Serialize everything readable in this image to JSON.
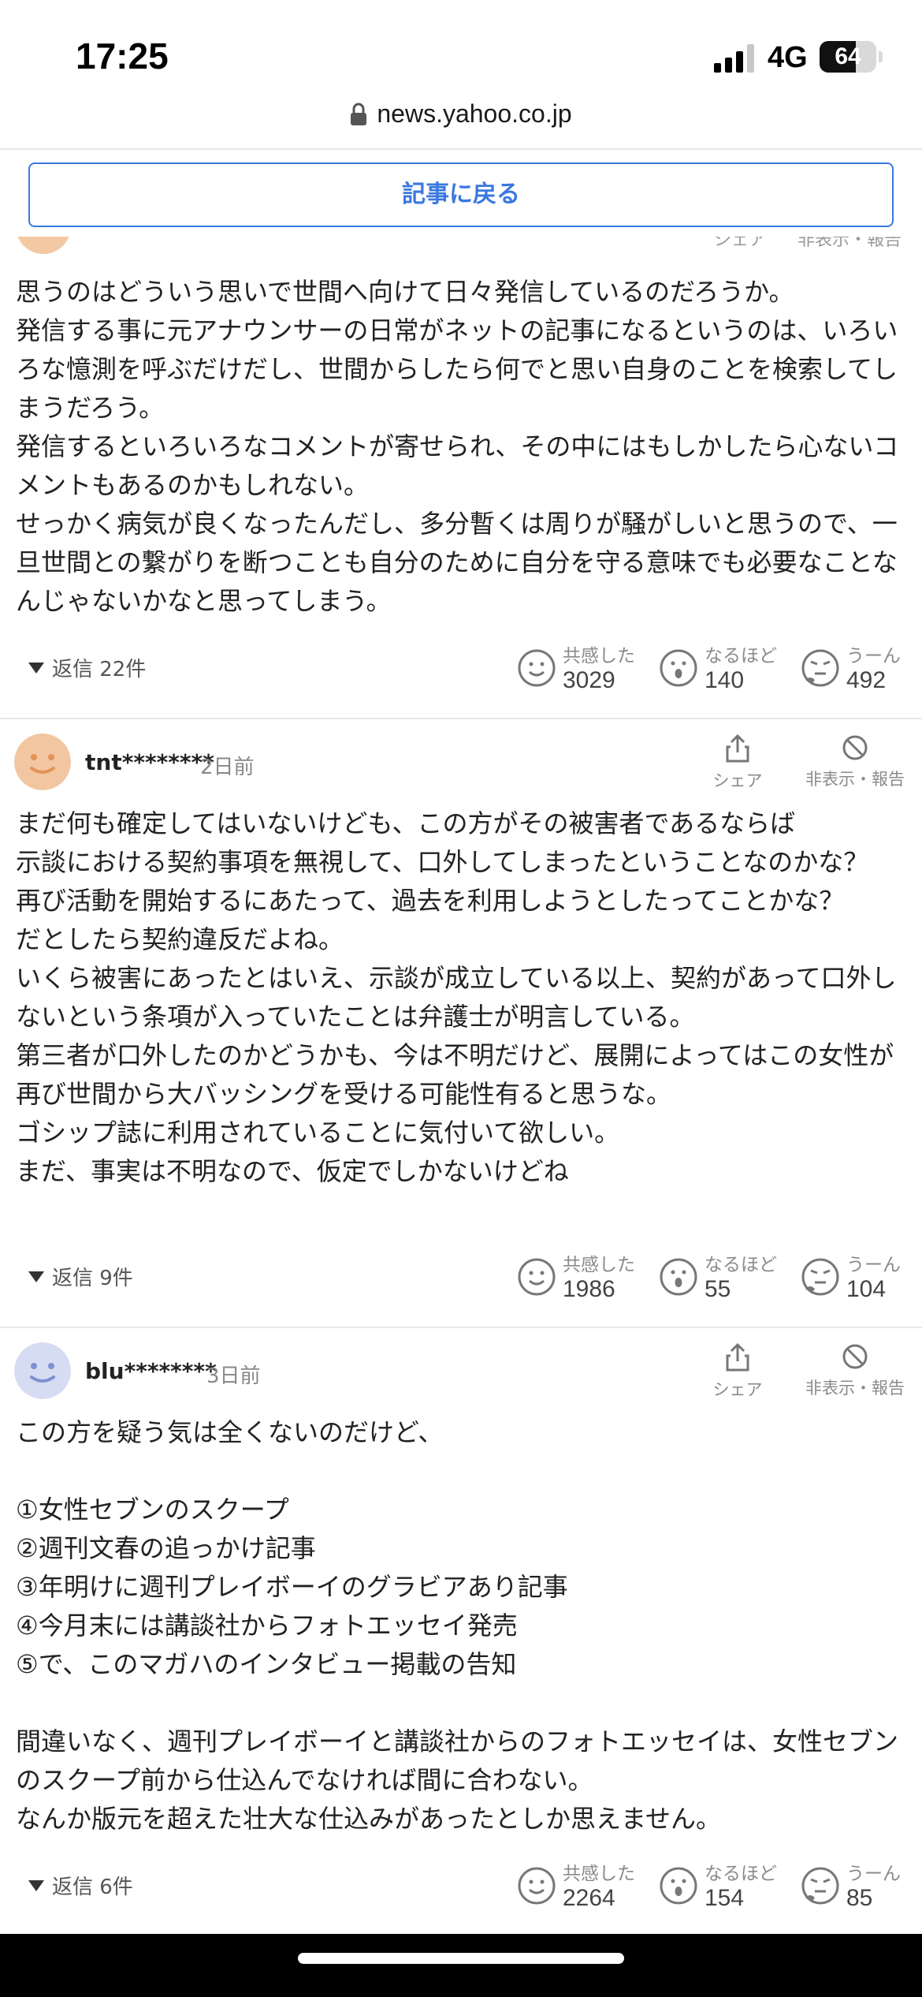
{
  "status_bar": {
    "time": "17:25",
    "network": "4G",
    "battery": "64",
    "battery_level": 0.64
  },
  "url_bar": {
    "url": "news.yahoo.co.jp"
  },
  "back_button": {
    "label": "記事に戻る"
  },
  "clipped_header": {
    "share_label": "シェア",
    "hide_report_label": "非表示・報告"
  },
  "comments": [
    {
      "text": "思うのはどういう思いで世間へ向けて日々発信しているのだろうか。\n発信する事に元アナウンサーの日常がネットの記事になるというのは、いろいろな憶測を呼ぶだけだし、世間からしたら何でと思い自身のことを検索してしまうだろう。\n発信するといろいろなコメントが寄せられ、その中にはもしかしたら心ないコメントもあるのかもしれない。\nせっかく病気が良くなったんだし、多分暫くは周りが騒がしいと思うので、一旦世間との繋がりを断つことも自分のために自分を守る意味でも必要なことなんじゃないかなと思ってしまう。",
      "replies": "返信 22件",
      "reactions": {
        "empathy_label": "共感した",
        "empathy": "3029",
        "indeed_label": "なるほど",
        "indeed": "140",
        "hmm_label": "うーん",
        "hmm": "492"
      }
    },
    {
      "user": "tnt********",
      "posted": "2日前",
      "share_label": "シェア",
      "hide_report_label": "非表示・報告",
      "avatar_color": "#f2c6a0",
      "text": "まだ何も確定してはいないけども、この方がその被害者であるならば\n示談における契約事項を無視して、口外してしまったということなのかな？\n再び活動を開始するにあたって、過去を利用しようとしたってことかな？\nだとしたら契約違反だよね。\nいくら被害にあったとはいえ、示談が成立している以上、契約があって口外しないという条項が入っていたことは弁護士が明言している。\n第三者が口外したのかどうかも、今は不明だけど、展開によってはこの女性が再び世間から大バッシングを受ける可能性有ると思うな。\nゴシップ誌に利用されていることに気付いて欲しい。\nまだ、事実は不明なので、仮定でしかないけどね",
      "replies": "返信 9件",
      "reactions": {
        "empathy_label": "共感した",
        "empathy": "1986",
        "indeed_label": "なるほど",
        "indeed": "55",
        "hmm_label": "うーん",
        "hmm": "104"
      }
    },
    {
      "user": "blu********",
      "posted": "3日前",
      "share_label": "シェア",
      "hide_report_label": "非表示・報告",
      "avatar_color": "#d6dcf2",
      "text": "この方を疑う気は全くないのだけど、\n\n①女性セブンのスクープ\n②週刊文春の追っかけ記事\n③年明けに週刊プレイボーイのグラビアあり記事\n④今月末には講談社からフォトエッセイ発売\n⑤で、このマガハのインタビュー掲載の告知\n\n間違いなく、週刊プレイボーイと講談社からのフォトエッセイは、女性セブンのスクープ前から仕込んでなければ間に合わない。\nなんか版元を超えた壮大な仕込みがあったとしか思えません。",
      "replies": "返信 6件",
      "reactions": {
        "empathy_label": "共感した",
        "empathy": "2264",
        "indeed_label": "なるほど",
        "indeed": "154",
        "hmm_label": "うーん",
        "hmm": "85"
      }
    }
  ]
}
